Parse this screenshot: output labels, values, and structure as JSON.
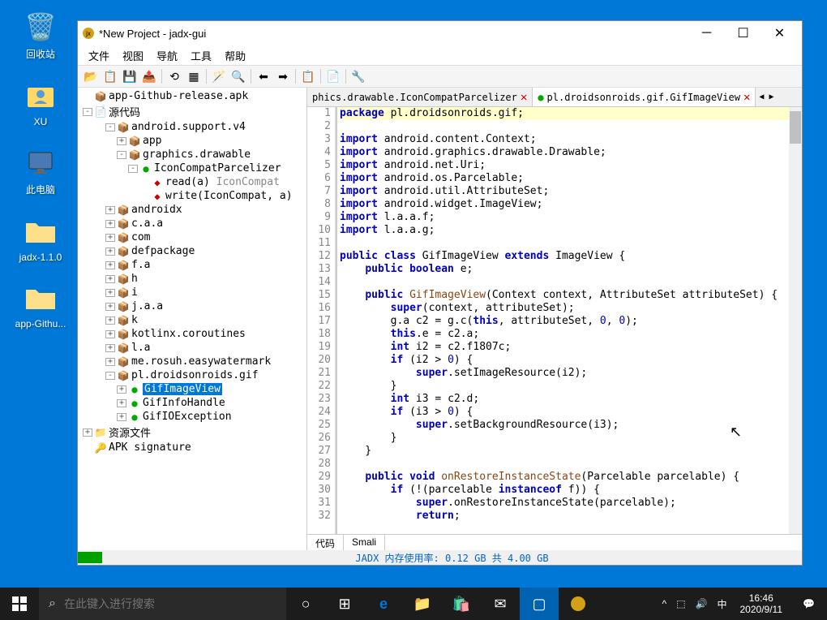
{
  "desktop": {
    "icons": [
      {
        "label": "回收站",
        "glyph": "🗑️"
      },
      {
        "label": "XU",
        "glyph": "📁"
      },
      {
        "label": "此电脑",
        "glyph": "💻"
      },
      {
        "label": "jadx-1.1.0",
        "glyph": "📁"
      },
      {
        "label": "app-Githu...",
        "glyph": "📁"
      }
    ]
  },
  "window": {
    "title": "*New Project - jadx-gui",
    "menus": [
      "文件",
      "视图",
      "导航",
      "工具",
      "帮助"
    ],
    "tree": {
      "root": "app-Github-release.apk",
      "source": "源代码",
      "packages": [
        {
          "name": "android.support.v4",
          "ind": 2,
          "expand": "-"
        },
        {
          "name": "app",
          "ind": 3,
          "expand": "+"
        },
        {
          "name": "graphics.drawable",
          "ind": 3,
          "expand": "-"
        },
        {
          "name": "IconCompatParcelizer",
          "ind": 4,
          "expand": "-",
          "type": "class"
        },
        {
          "name": "read(a)",
          "suffix": "IconCompat",
          "ind": 5,
          "type": "method"
        },
        {
          "name": "write(IconCompat, a)",
          "ind": 5,
          "type": "method"
        },
        {
          "name": "androidx",
          "ind": 2,
          "expand": "+"
        },
        {
          "name": "c.a.a",
          "ind": 2,
          "expand": "+"
        },
        {
          "name": "com",
          "ind": 2,
          "expand": "+"
        },
        {
          "name": "defpackage",
          "ind": 2,
          "expand": "+"
        },
        {
          "name": "f.a",
          "ind": 2,
          "expand": "+"
        },
        {
          "name": "h",
          "ind": 2,
          "expand": "+"
        },
        {
          "name": "i",
          "ind": 2,
          "expand": "+"
        },
        {
          "name": "j.a.a",
          "ind": 2,
          "expand": "+"
        },
        {
          "name": "k",
          "ind": 2,
          "expand": "+"
        },
        {
          "name": "kotlinx.coroutines",
          "ind": 2,
          "expand": "+"
        },
        {
          "name": "l.a",
          "ind": 2,
          "expand": "+"
        },
        {
          "name": "me.rosuh.easywatermark",
          "ind": 2,
          "expand": "+"
        },
        {
          "name": "pl.droidsonroids.gif",
          "ind": 2,
          "expand": "-"
        },
        {
          "name": "GifImageView",
          "ind": 3,
          "expand": "+",
          "type": "class",
          "selected": true
        },
        {
          "name": "GifInfoHandle",
          "ind": 3,
          "expand": "+",
          "type": "class"
        },
        {
          "name": "GifIOException",
          "ind": 3,
          "expand": "+",
          "type": "class"
        }
      ],
      "resources": "资源文件",
      "signature": "APK signature"
    },
    "tabs": {
      "tab1": "phics.drawable.IconCompatParcelizer",
      "tab2": "pl.droidsonroids.gif.GifImageView"
    },
    "bottomTabs": [
      "代码",
      "Smali"
    ],
    "status": "JADX 内存使用率: 0.12 GB 共 4.00 GB"
  },
  "taskbar": {
    "searchPlaceholder": "在此键入进行搜索",
    "ime": "中",
    "time": "16:46",
    "date": "2020/9/11"
  }
}
